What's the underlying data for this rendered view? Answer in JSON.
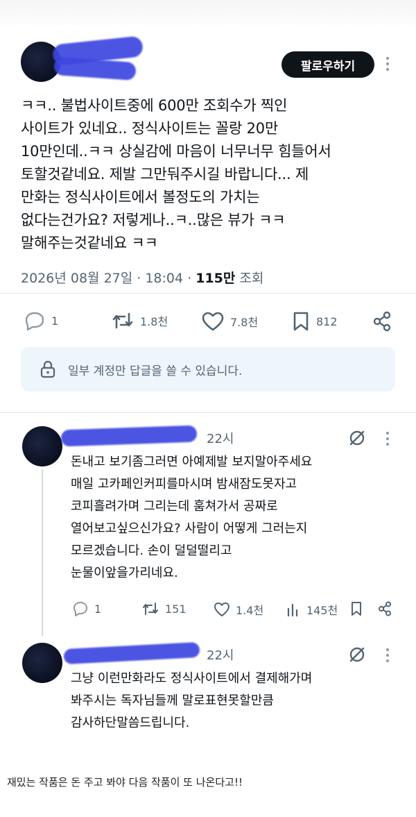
{
  "post": {
    "follow_label": "팔로우하기",
    "text": "ㅋㅋ.. 불법사이트중에 600만 조회수가 찍인\n사이트가 있네요.. 정식사이트는 꼴랑 20만\n10만인데..ㅋㅋ 상실감에 마음이 너무너무 힘들어서\n토할것같네요. 제발 그만둬주시길 바랍니다... 제\n만화는 정식사이트에서 볼정도의 가치는\n없다는건가요? 저렇게나..ㅋ..많은 뷰가 ㅋㅋ\n말해주는것같네요 ㅋㅋ",
    "timestamp": "2026년 08월 27일 · 18:04 · ",
    "views_count": "115만",
    "views_label": " 조회",
    "stats": {
      "replies": "1",
      "reposts": "1.8천",
      "likes": "7.8천",
      "bookmarks": "812"
    },
    "reply_restriction": "일부 계정만 답글을 쓸 수 있습니다."
  },
  "replies": [
    {
      "time": "22시",
      "text": "돈내고 보기좀그러면 아예제발 보지말아주세요\n매일 고카페인커피를마시며 밤새잠도못자고\n코피흘려가며 그리는데 훔쳐가서 공짜로\n열어보고싶으신가요? 사람이 어떻게 그러는지\n모르겠습니다. 손이 덜덜떨리고\n눈물이앞을가리네요.",
      "stats": {
        "replies": "1",
        "reposts": "151",
        "likes": "1.4천",
        "views": "145천"
      }
    },
    {
      "time": "22시",
      "text": "그냥 이런만화라도 정식사이트에서 결제해가며\n봐주시는 독자님들께 말로표현못할만큼\n감사하단말씀드립니다."
    }
  ],
  "caption": "재밌는 작품은 돈 주고 봐야 다음 작품이 또 나온다고!!",
  "colors": {
    "accent_scribble": "#3d46e0",
    "text_primary": "#0f1419",
    "text_secondary": "#536471",
    "restriction_bg": "#eef5fb"
  }
}
